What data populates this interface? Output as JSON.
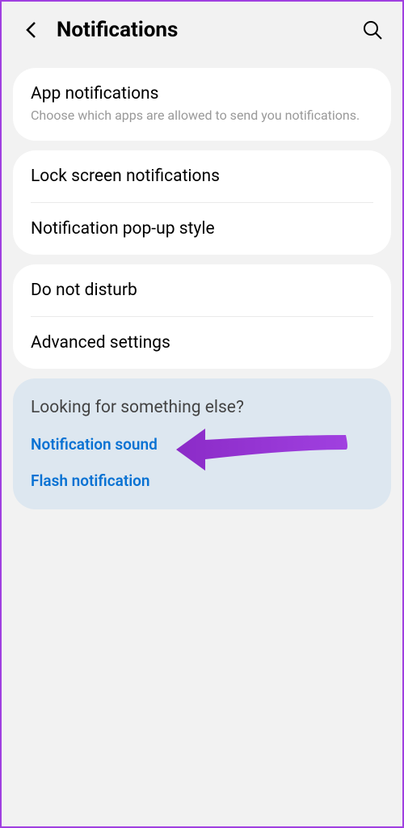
{
  "header": {
    "title": "Notifications"
  },
  "card1": {
    "item1": {
      "title": "App notifications",
      "subtitle": "Choose which apps are allowed to send you notifications."
    }
  },
  "card2": {
    "item1": {
      "title": "Lock screen notifications"
    },
    "item2": {
      "title": "Notification pop-up style"
    }
  },
  "card3": {
    "item1": {
      "title": "Do not disturb"
    },
    "item2": {
      "title": "Advanced settings"
    }
  },
  "suggestions": {
    "title": "Looking for something else?",
    "link1": "Notification sound",
    "link2": "Flash notification"
  }
}
